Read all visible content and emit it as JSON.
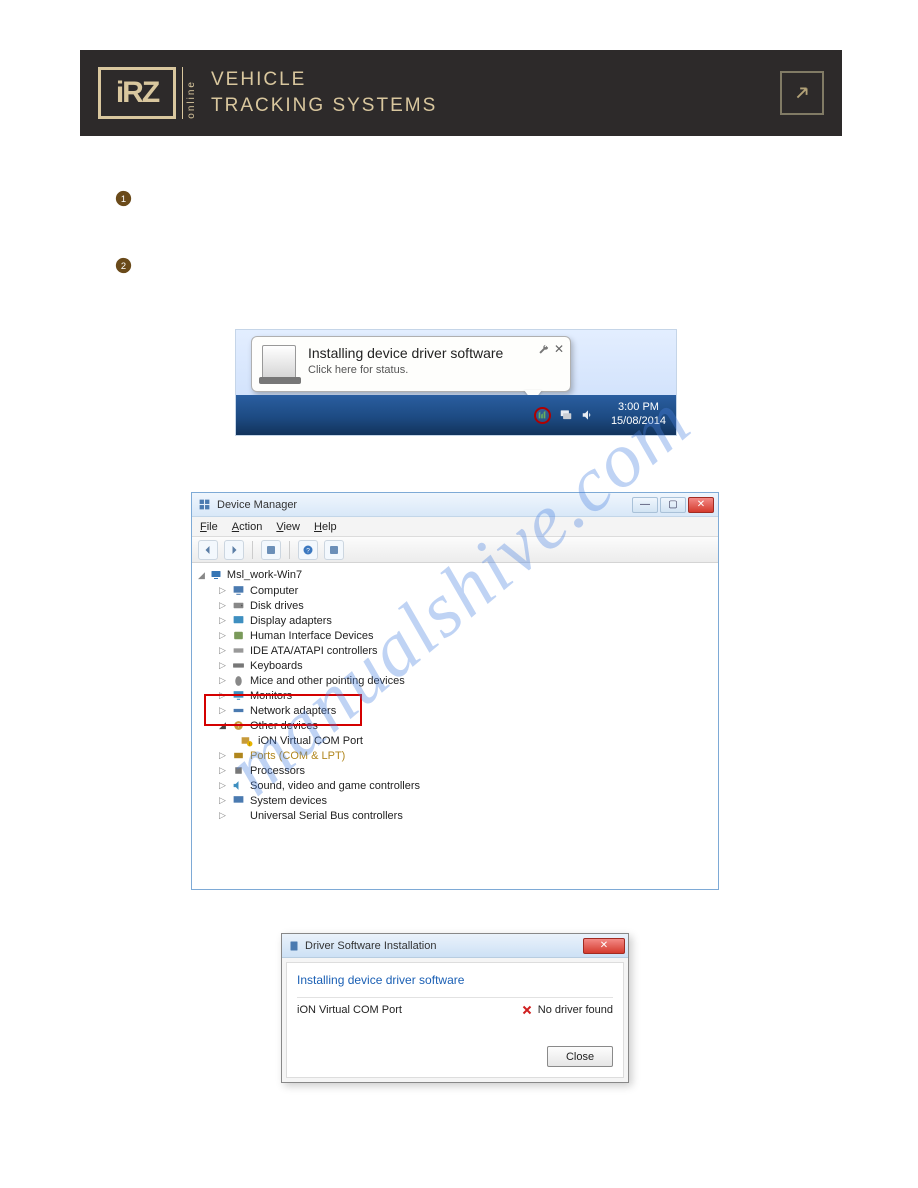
{
  "header": {
    "logo_text": "iRZ",
    "logo_side": "online",
    "title_line1": "VEHICLE",
    "title_line2": "TRACKING SYSTEMS"
  },
  "watermark": "manualshive.com",
  "bullets": [
    "1",
    "2"
  ],
  "fig1": {
    "balloon_title": "Installing device driver software",
    "balloon_sub": "Click here for status.",
    "clock_time": "3:00 PM",
    "clock_date": "15/08/2014"
  },
  "device_manager": {
    "window_title": "Device Manager",
    "menu": {
      "file": "File",
      "action": "Action",
      "view": "View",
      "help": "Help"
    },
    "root": "Msl_work-Win7",
    "items": [
      "Computer",
      "Disk drives",
      "Display adapters",
      "Human Interface Devices",
      "IDE ATA/ATAPI controllers",
      "Keyboards",
      "Mice and other pointing devices",
      "Monitors",
      "Network adapters",
      "Other devices",
      "Ports (COM & LPT)",
      "Processors",
      "Sound, video and game controllers",
      "System devices",
      "Universal Serial Bus controllers"
    ],
    "other_device_child": "iON Virtual COM Port"
  },
  "driver_dialog": {
    "title": "Driver Software Installation",
    "heading": "Installing device driver software",
    "device": "iON Virtual COM Port",
    "status": "No driver found",
    "close": "Close"
  }
}
